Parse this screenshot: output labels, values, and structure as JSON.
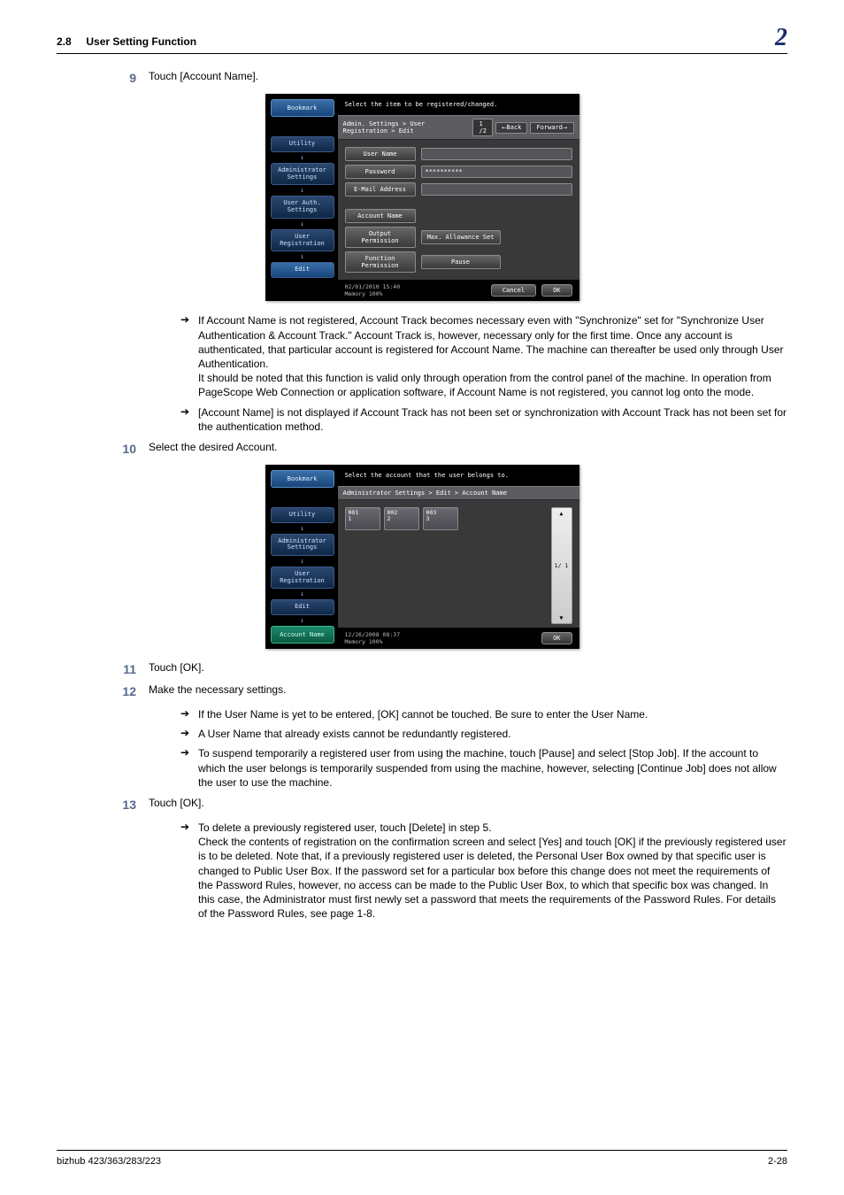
{
  "header": {
    "section": "2.8",
    "title": "User Setting Function",
    "chapter": "2"
  },
  "steps": {
    "s9": {
      "num": "9",
      "text": "Touch [Account Name]."
    },
    "s10": {
      "num": "10",
      "text": "Select the desired Account."
    },
    "s11": {
      "num": "11",
      "text": "Touch [OK]."
    },
    "s12": {
      "num": "12",
      "text": "Make the necessary settings."
    },
    "s13": {
      "num": "13",
      "text": "Touch [OK]."
    }
  },
  "notes_after_9": [
    "If Account Name is not registered, Account Track becomes necessary even with \"Synchronize\" set for \"Synchronize User Authentication & Account Track.\" Account Track is, however, necessary only for the first time. Once any account is authenticated, that particular account is registered for Account Name. The machine can thereafter be used only through User Authentication.\nIt should be noted that this function is valid only through operation from the control panel of the machine. In operation from PageScope Web Connection or application software, if Account Name is not registered, you cannot log onto the mode.",
    "[Account Name] is not displayed if Account Track has not been set or synchronization with Account Track has not been set for the authentication method."
  ],
  "notes_after_12": [
    "If the User Name is yet to be entered, [OK] cannot be touched. Be sure to enter the User Name.",
    "A User Name that already exists cannot be redundantly registered.",
    "To suspend temporarily a registered user from using the machine, touch [Pause] and select [Stop Job]. If the account to which the user belongs is temporarily suspended from using the machine, however, selecting [Continue Job] does not allow the user to use the machine."
  ],
  "notes_after_13": [
    "To delete a previously registered user, touch [Delete] in step 5.\nCheck the contents of registration on the confirmation screen and select [Yes] and touch [OK] if the previously registered user is to be deleted. Note that, if a previously registered user is deleted, the Personal User Box owned by that specific user is changed to Public User Box. If the password set for a particular box before this change does not meet the requirements of the Password Rules, however, no access can be made to the Public User Box, to which that specific box was changed. In this case, the Administrator must first newly set a password that meets the requirements of the Password Rules. For details of the Password Rules, see page 1-8."
  ],
  "shot1": {
    "topmsg": "Select the item to be registered/changed.",
    "breadcrumb": "Admin. Settings > User Registration > Edit",
    "page": "1 /2",
    "back": "Back",
    "forward": "Forward",
    "side": {
      "bookmark": "Bookmark",
      "utility": "Utility",
      "admin": "Administrator\nSettings",
      "userauth": "User Auth.\nSettings",
      "userreg": "User\nRegistration",
      "edit": "Edit"
    },
    "fields": {
      "user_name": "User Name",
      "password": "Password",
      "password_val": "**********",
      "email": "E-Mail Address",
      "account_name": "Account Name",
      "output_perm": "Output Permission",
      "max_allow": "Max. Allowance Set",
      "func_perm": "Function Permission",
      "pause": "Pause"
    },
    "status": {
      "datetime": "02/01/2010   15:40",
      "memory": "Memory        100%",
      "cancel": "Cancel",
      "ok": "OK"
    }
  },
  "shot2": {
    "topmsg": "Select the account that the user belongs to.",
    "breadcrumb": "Administrator Settings > Edit > Account Name",
    "side": {
      "bookmark": "Bookmark",
      "utility": "Utility",
      "admin": "Administrator\nSettings",
      "userreg": "User\nRegistration",
      "edit": "Edit",
      "account": "Account Name"
    },
    "accounts": [
      {
        "code": "001",
        "label": "1"
      },
      {
        "code": "002",
        "label": "2"
      },
      {
        "code": "003",
        "label": "3"
      }
    ],
    "scroll": "1/  1",
    "status": {
      "datetime": "12/26/2008   08:37",
      "memory": "Memory        100%",
      "ok": "OK"
    }
  },
  "footer": {
    "left": "bizhub 423/363/283/223",
    "right": "2-28"
  }
}
